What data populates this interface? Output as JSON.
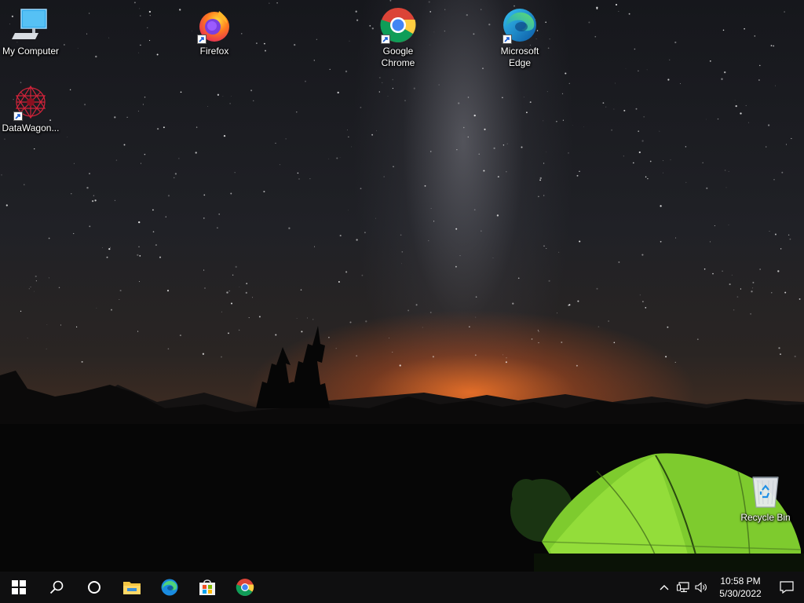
{
  "desktop": {
    "icons": [
      {
        "label": "My Computer",
        "icon": "computer-icon"
      },
      {
        "label": "Firefox",
        "icon": "firefox-icon"
      },
      {
        "label": "Google Chrome",
        "icon": "chrome-icon"
      },
      {
        "label": "Microsoft Edge",
        "icon": "edge-icon"
      },
      {
        "label": "DataWagon...",
        "icon": "datawagon-icon"
      },
      {
        "label": "Recycle Bin",
        "icon": "recycle-bin-icon"
      }
    ]
  },
  "taskbar": {
    "pinned": [
      "start-icon",
      "search-icon",
      "cortana-icon",
      "file-explorer-icon",
      "edge-icon",
      "store-icon",
      "chrome-icon"
    ],
    "tray": [
      "chevron-up-icon",
      "network-icon",
      "volume-icon"
    ],
    "clock": {
      "time": "10:58 PM",
      "date": "5/30/2022"
    },
    "notification_icon": "action-center-icon"
  },
  "colors": {
    "taskbar_bg": "#0f0f10",
    "horizon_glow": "#ff7a2a",
    "tent": "#8fd23a"
  }
}
